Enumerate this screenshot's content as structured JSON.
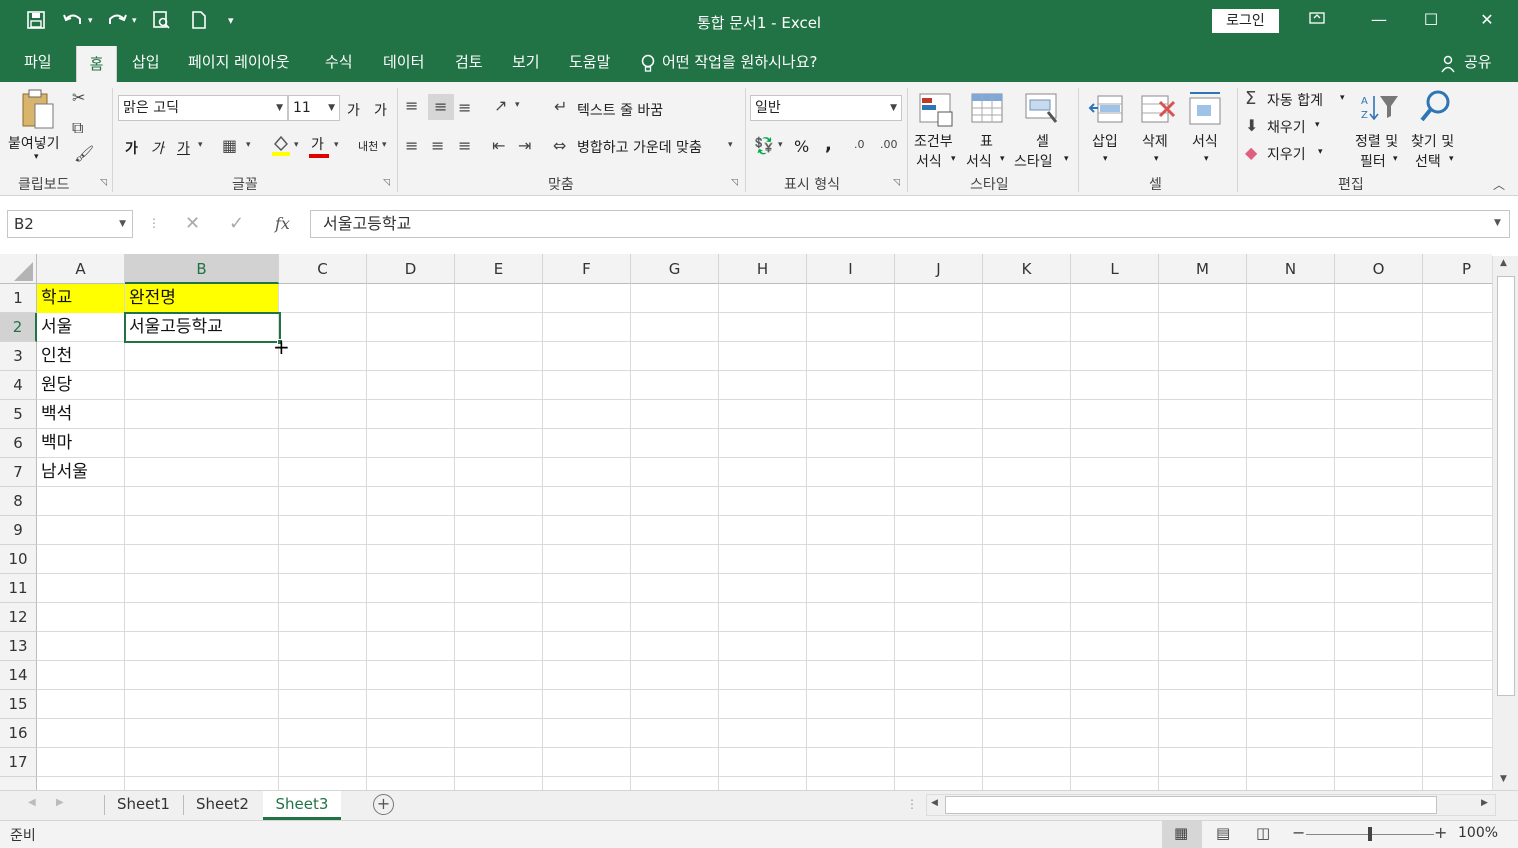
{
  "window": {
    "title": "통합 문서1  -  Excel",
    "login_label": "로그인",
    "accent": "#217346"
  },
  "quick_access": {
    "icons": [
      "save-icon",
      "undo-icon",
      "redo-icon",
      "print-preview-icon",
      "new-document-icon",
      "customize-icon"
    ]
  },
  "tabs": [
    {
      "label": "파일"
    },
    {
      "label": "홈"
    },
    {
      "label": "삽입"
    },
    {
      "label": "페이지 레이아웃"
    },
    {
      "label": "수식"
    },
    {
      "label": "데이터"
    },
    {
      "label": "검토"
    },
    {
      "label": "보기"
    },
    {
      "label": "도움말"
    }
  ],
  "tell_me": "어떤 작업을 원하시나요?",
  "share_label": "공유",
  "ribbon": {
    "clipboard": {
      "label": "클립보드",
      "paste": "붙여넣기"
    },
    "font": {
      "label": "글꼴",
      "font_name": "맑은 고딕",
      "font_size": "11",
      "grow": "가",
      "shrink": "가",
      "bold": "가",
      "italic": "가",
      "underline": "가",
      "font_color": "가",
      "phonetic": "내천"
    },
    "alignment": {
      "label": "맞춤",
      "wrap_text": "텍스트 줄 바꿈",
      "merge_center": "병합하고 가운데 맞춤"
    },
    "number": {
      "label": "표시 형식",
      "format": "일반",
      "percent": "%",
      "comma": ","
    },
    "styles": {
      "label": "스타일",
      "conditional_1": "조건부",
      "conditional_2": "서식",
      "table_1": "표",
      "table_2": "서식",
      "cell_style_1": "셀",
      "cell_style_2": "스타일"
    },
    "cells": {
      "label": "셀",
      "insert": "삽입",
      "delete": "삭제",
      "format": "서식"
    },
    "editing": {
      "label": "편집",
      "autosum": "자동 합계",
      "fill": "채우기",
      "clear": "지우기",
      "sort_1": "정렬 및",
      "sort_2": "필터",
      "find_1": "찾기 및",
      "find_2": "선택"
    }
  },
  "formula_bar": {
    "name_box": "B2",
    "fx": "fx",
    "value": "서울고등학교"
  },
  "sheet": {
    "columns": [
      "A",
      "B",
      "C",
      "D",
      "E",
      "F",
      "G",
      "H",
      "I",
      "J",
      "K",
      "L",
      "M",
      "N",
      "O",
      "P"
    ],
    "rows": [
      "1",
      "2",
      "3",
      "4",
      "5",
      "6",
      "7",
      "8",
      "9",
      "10",
      "11",
      "12",
      "13",
      "14",
      "15",
      "16",
      "17"
    ],
    "cells": {
      "A1": "학교",
      "B1": "완전명",
      "A2": "서울",
      "B2": "서울고등학교",
      "A3": "인천",
      "A4": "원당",
      "A5": "백석",
      "A6": "백마",
      "A7": "남서울"
    },
    "highlight_color": "#ffff00",
    "selected_cell": "B2"
  },
  "sheet_tabs": [
    {
      "label": "Sheet1"
    },
    {
      "label": "Sheet2"
    },
    {
      "label": "Sheet3"
    }
  ],
  "status": {
    "ready": "준비",
    "zoom": "100%"
  }
}
